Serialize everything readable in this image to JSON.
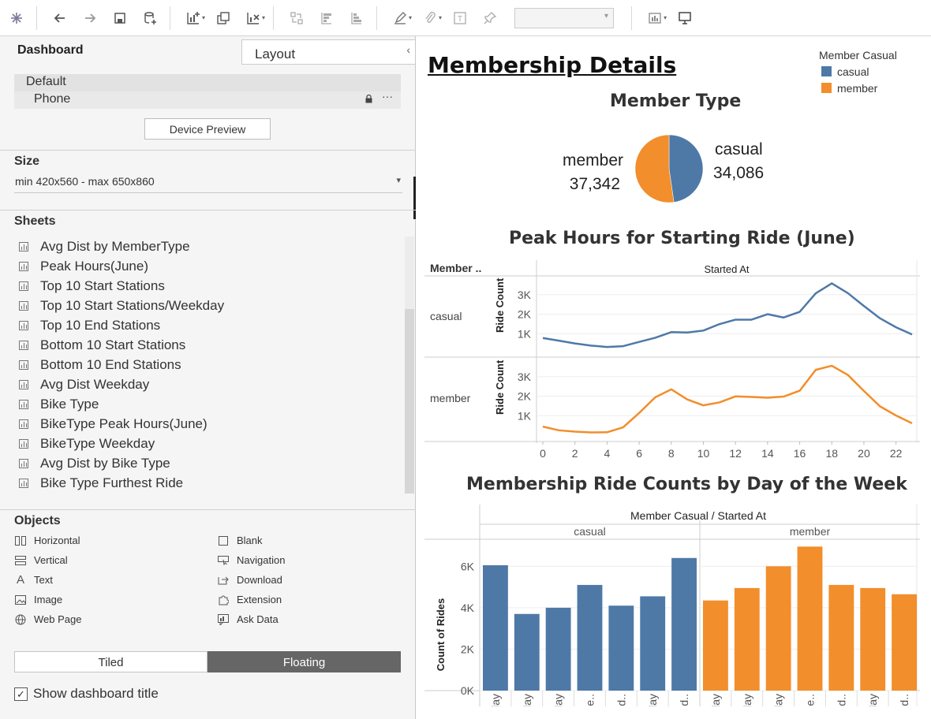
{
  "toolbar": {
    "icons": [
      "tableau-logo-icon",
      "undo-icon",
      "redo-icon",
      "save-icon",
      "new-datasource-icon",
      "new-worksheet-icon",
      "duplicate-sheet-icon",
      "clear-sheet-icon",
      "swap-icon",
      "sort-ascending-icon",
      "sort-descending-icon",
      "highlight-icon",
      "group-icon",
      "label-icon",
      "pin-icon",
      "show-me-icon",
      "presentation-icon"
    ],
    "fit_value": ""
  },
  "left_panel": {
    "tab_dashboard": "Dashboard",
    "tab_layout": "Layout",
    "devices": {
      "default": "Default",
      "phone": "Phone",
      "more": "···"
    },
    "device_preview_button": "Device Preview",
    "size": {
      "title": "Size",
      "value": "min 420x560 - max 650x860"
    },
    "sheets": {
      "title": "Sheets",
      "items": [
        "Avg Dist by MemberType",
        "Peak Hours(June)",
        "Top 10 Start Stations",
        "Top 10 Start Stations/Weekday",
        "Top 10 End Stations",
        "Bottom 10 Start Stations",
        "Bottom 10 End Stations",
        "Avg Dist Weekday",
        "Bike Type",
        "BikeType Peak Hours(June)",
        "BikeType Weekday",
        "Avg Dist by Bike Type",
        "Bike Type Furthest Ride"
      ]
    },
    "objects": {
      "title": "Objects",
      "left": [
        "Horizontal",
        "Vertical",
        "Text",
        "Image",
        "Web Page"
      ],
      "right": [
        "Blank",
        "Navigation",
        "Download",
        "Extension",
        "Ask Data"
      ]
    },
    "tiled": "Tiled",
    "floating": "Floating",
    "show_title": "Show dashboard title",
    "show_title_checked": true
  },
  "dashboard": {
    "title": "Membership Details",
    "legend": {
      "title": "Member Casual",
      "items": [
        {
          "label": "casual",
          "color": "#4e79a7"
        },
        {
          "label": "member",
          "color": "#f28e2b"
        }
      ]
    }
  },
  "chart_data": [
    {
      "type": "pie",
      "title": "Member Type",
      "slices": [
        {
          "label": "casual",
          "value": 34086,
          "value_text": "34,086",
          "color": "#4e79a7"
        },
        {
          "label": "member",
          "value": 37342,
          "value_text": "37,342",
          "color": "#f28e2b"
        }
      ]
    },
    {
      "type": "line",
      "title": "Peak Hours for Starting Ride (June)",
      "row_header": "Member ..",
      "column_header": "Started At",
      "ylabel": "Ride Count",
      "x": [
        0,
        1,
        2,
        3,
        4,
        5,
        6,
        7,
        8,
        9,
        10,
        11,
        12,
        13,
        14,
        15,
        16,
        17,
        18,
        19,
        20,
        21,
        22,
        23
      ],
      "x_ticks": [
        "0",
        "2",
        "4",
        "6",
        "8",
        "10",
        "12",
        "14",
        "16",
        "18",
        "20",
        "22"
      ],
      "y_ticks": [
        "1K",
        "2K",
        "3K"
      ],
      "ylim": [
        0,
        3800
      ],
      "series": [
        {
          "name": "casual",
          "color": "#4e79a7",
          "values": [
            780,
            640,
            500,
            390,
            320,
            360,
            580,
            790,
            1080,
            1060,
            1160,
            1490,
            1720,
            1720,
            2000,
            1830,
            2120,
            3070,
            3580,
            3080,
            2420,
            1790,
            1330,
            960
          ]
        },
        {
          "name": "member",
          "color": "#f28e2b",
          "values": [
            440,
            250,
            180,
            140,
            150,
            400,
            1140,
            1940,
            2350,
            1830,
            1530,
            1680,
            1990,
            1960,
            1920,
            1980,
            2280,
            3350,
            3560,
            3090,
            2270,
            1480,
            1010,
            610
          ]
        }
      ]
    },
    {
      "type": "bar",
      "title": "Membership Ride Counts by Day of the Week",
      "column_header": "Member Casual  /  Started At",
      "ylabel": "Count of Rides",
      "y_ticks": [
        "0K",
        "2K",
        "4K",
        "6K"
      ],
      "ylim": [
        0,
        7000
      ],
      "panels": [
        {
          "name": "casual",
          "color": "#4e79a7",
          "categories": [
            "Sunday",
            "Monday",
            "Tuesday",
            "Wedne..",
            "Thursd..",
            "Friday",
            "Saturd.."
          ],
          "values": [
            6050,
            3700,
            4000,
            5100,
            4100,
            4550,
            6400
          ]
        },
        {
          "name": "member",
          "color": "#f28e2b",
          "categories": [
            "Sunday",
            "Monday",
            "Tuesday",
            "Wedne..",
            "Thursd..",
            "Friday",
            "Saturd.."
          ],
          "values": [
            4350,
            4950,
            6000,
            6950,
            5100,
            4950,
            4650
          ]
        }
      ]
    }
  ]
}
